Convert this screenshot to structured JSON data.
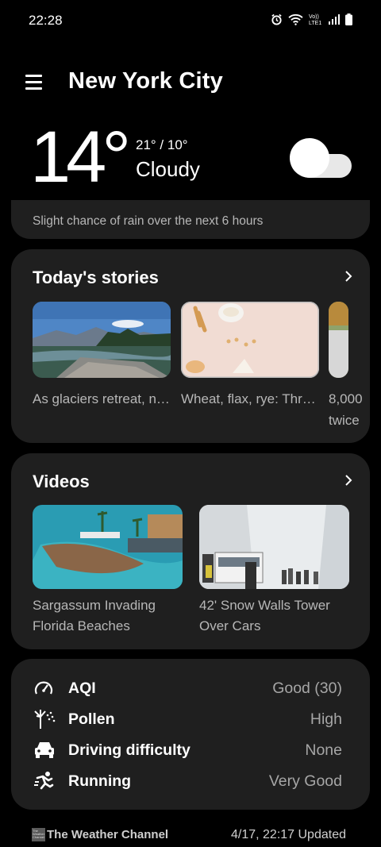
{
  "status_bar": {
    "time": "22:28",
    "icons": [
      "alarm-icon",
      "wifi-icon",
      "volte-icon",
      "signal-icon",
      "battery-icon"
    ]
  },
  "header": {
    "city": "New York City"
  },
  "current": {
    "temperature": "14°",
    "hi_lo": "21° / 10°",
    "condition": "Cloudy",
    "icon": "cloud-icon"
  },
  "summary": "Slight chance of rain over the next 6 hours",
  "stories": {
    "title": "Today's stories",
    "items": [
      {
        "text": "As glaciers retreat, new streams for salmon"
      },
      {
        "text": "Wheat, flax, rye: Three grains to fight the signs"
      },
      {
        "text": "8,000 twice"
      }
    ]
  },
  "videos": {
    "title": "Videos",
    "items": [
      {
        "line1": "Sargassum Invading",
        "line2": "Florida Beaches"
      },
      {
        "line1": "42' Snow Walls Tower",
        "line2": "Over Cars"
      }
    ]
  },
  "metrics": [
    {
      "icon": "gauge-icon",
      "label": "AQI",
      "value": "Good (30)"
    },
    {
      "icon": "pollen-icon",
      "label": "Pollen",
      "value": "High"
    },
    {
      "icon": "car-icon",
      "label": "Driving difficulty",
      "value": "None"
    },
    {
      "icon": "running-icon",
      "label": "Running",
      "value": "Very Good"
    }
  ],
  "footer": {
    "logo_text": "The Weather Channel",
    "brand": "The Weather Channel",
    "updated": "4/17, 22:17 Updated"
  }
}
